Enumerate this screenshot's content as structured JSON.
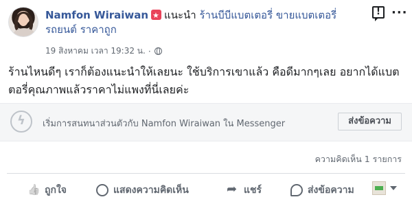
{
  "post": {
    "author": "Namfon Wiraiwan",
    "action": "แนะนำ",
    "page": "ร้านบีบีแบตเตอรี่ ขายแบตเตอรี่รถยนต์ ราคาถูก",
    "timestamp": "19 สิงหาคม เวลา 19:32 น.",
    "separator": "·",
    "text": "ร้านไหนดีๆ เราก็ต้องแนะนำให้เลยนะ ใช้บริการเขาแล้ว คือดีมากๆเลย อยากได้แบตตอรี่คุณภาพแล้วราคาไม่แพงที่นี่เลยค่ะ"
  },
  "messenger": {
    "prompt": "เริ่มการสนทนาส่วนตัวกับ Namfon Wiraiwan ใน Messenger",
    "button_label": "ส่งข้อความ"
  },
  "comments": {
    "count_text": "ความคิดเห็น 1 รายการ"
  },
  "actions": {
    "like": "ถูกใจ",
    "comment": "แสดงความคิดเห็น",
    "share": "แชร์",
    "message": "ส่งข้อความ"
  },
  "icons": {
    "badge": "recommend-star-icon",
    "globe": "globe-icon",
    "report": "report-icon",
    "more": "more-icon",
    "messenger": "messenger-icon",
    "like": "thumbs-up-icon",
    "comment": "comment-icon",
    "share": "share-icon",
    "message": "message-icon"
  },
  "colors": {
    "link": "#365899",
    "badge": "#e9435a",
    "muted": "#606770"
  }
}
